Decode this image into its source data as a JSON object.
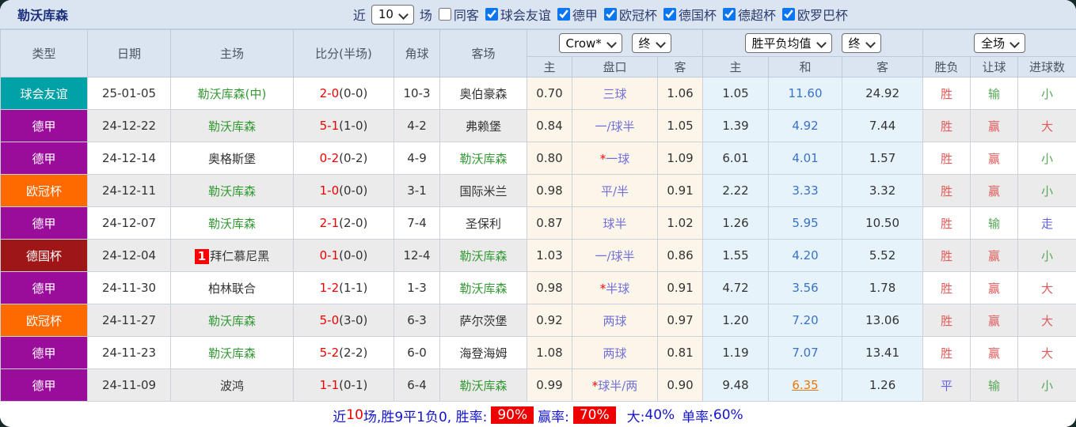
{
  "page": {
    "title": "勒沃库森"
  },
  "colors": {
    "accent_blue": "#0b76ef",
    "self_green": "#339933",
    "score_red": "#ee0000",
    "handicap_blue": "#7070d8",
    "draw_blue": "#3a72c8",
    "result_red": "#e05b5b",
    "result_green": "#57a657",
    "result_blue": "#6161e0",
    "highlight_orange": "#e8760d",
    "summary_blue": "#1414cc",
    "summary_red": "#ee0000"
  },
  "topbar": {
    "near_label": "近",
    "count_value": "10",
    "matches_label": "场",
    "same_venue_label": "同客",
    "same_venue_checked": false,
    "league_filters": [
      {
        "label": "球会友谊",
        "checked": true
      },
      {
        "label": "德甲",
        "checked": true
      },
      {
        "label": "欧冠杯",
        "checked": true
      },
      {
        "label": "德国杯",
        "checked": true
      },
      {
        "label": "德超杯",
        "checked": true
      },
      {
        "label": "欧罗巴杯",
        "checked": true
      }
    ]
  },
  "table": {
    "headers": {
      "type": "类型",
      "date": "日期",
      "home": "主场",
      "score": "比分(半场)",
      "corner": "角球",
      "away": "客场"
    },
    "selects": {
      "company": "Crow*",
      "company_time": "终",
      "avg_type": "胜平负均值",
      "avg_time": "终",
      "scope": "全场"
    },
    "sub_headers": [
      "主",
      "盘口",
      "客",
      "主",
      "和",
      "客",
      "胜负",
      "让球",
      "进球数"
    ],
    "league_colors": {
      "球会友谊": "#00a1a7",
      "德甲": "#9a0d9a",
      "欧冠杯": "#ff6a00",
      "德国杯": "#9e1616"
    },
    "rows": [
      {
        "league": "球会友谊",
        "date": "25-01-05",
        "home": "勒沃库森(中)",
        "home_self": true,
        "home_rank": "",
        "score": "2-0",
        "half": "(0-0)",
        "corner": "10-3",
        "away": "奥伯豪森",
        "away_self": false,
        "odds": [
          "0.70",
          "三球",
          "1.06"
        ],
        "star": false,
        "avg": [
          "1.05",
          "11.60",
          "24.92"
        ],
        "draw_highlight": false,
        "results": [
          [
            "胜",
            "red"
          ],
          [
            "输",
            "green"
          ],
          [
            "小",
            "green"
          ]
        ]
      },
      {
        "league": "德甲",
        "date": "24-12-22",
        "home": "勒沃库森",
        "home_self": true,
        "home_rank": "",
        "score": "5-1",
        "half": "(1-0)",
        "corner": "4-2",
        "away": "弗赖堡",
        "away_self": false,
        "odds": [
          "0.84",
          "一/球半",
          "1.05"
        ],
        "star": false,
        "avg": [
          "1.39",
          "4.92",
          "7.44"
        ],
        "draw_highlight": false,
        "results": [
          [
            "胜",
            "red"
          ],
          [
            "赢",
            "red"
          ],
          [
            "大",
            "red"
          ]
        ]
      },
      {
        "league": "德甲",
        "date": "24-12-14",
        "home": "奥格斯堡",
        "home_self": false,
        "home_rank": "",
        "score": "0-2",
        "half": "(0-2)",
        "corner": "4-9",
        "away": "勒沃库森",
        "away_self": true,
        "odds": [
          "0.80",
          "一球",
          "1.09"
        ],
        "star": true,
        "avg": [
          "6.01",
          "4.01",
          "1.57"
        ],
        "draw_highlight": false,
        "results": [
          [
            "胜",
            "red"
          ],
          [
            "赢",
            "red"
          ],
          [
            "小",
            "green"
          ]
        ]
      },
      {
        "league": "欧冠杯",
        "date": "24-12-11",
        "home": "勒沃库森",
        "home_self": true,
        "home_rank": "",
        "score": "1-0",
        "half": "(0-0)",
        "corner": "3-1",
        "away": "国际米兰",
        "away_self": false,
        "odds": [
          "0.98",
          "平/半",
          "0.91"
        ],
        "star": false,
        "avg": [
          "2.22",
          "3.33",
          "3.32"
        ],
        "draw_highlight": false,
        "results": [
          [
            "胜",
            "red"
          ],
          [
            "赢",
            "red"
          ],
          [
            "小",
            "green"
          ]
        ]
      },
      {
        "league": "德甲",
        "date": "24-12-07",
        "home": "勒沃库森",
        "home_self": true,
        "home_rank": "",
        "score": "2-1",
        "half": "(2-0)",
        "corner": "7-4",
        "away": "圣保利",
        "away_self": false,
        "odds": [
          "0.87",
          "球半",
          "1.02"
        ],
        "star": false,
        "avg": [
          "1.26",
          "5.95",
          "10.50"
        ],
        "draw_highlight": false,
        "results": [
          [
            "胜",
            "red"
          ],
          [
            "输",
            "green"
          ],
          [
            "走",
            "blue"
          ]
        ]
      },
      {
        "league": "德国杯",
        "date": "24-12-04",
        "home": "拜仁慕尼黑",
        "home_self": false,
        "home_rank": "1",
        "score": "0-1",
        "half": "(0-0)",
        "corner": "12-4",
        "away": "勒沃库森",
        "away_self": true,
        "odds": [
          "1.03",
          "一/球半",
          "0.86"
        ],
        "star": false,
        "avg": [
          "1.55",
          "4.20",
          "5.52"
        ],
        "draw_highlight": false,
        "results": [
          [
            "胜",
            "red"
          ],
          [
            "赢",
            "red"
          ],
          [
            "小",
            "green"
          ]
        ]
      },
      {
        "league": "德甲",
        "date": "24-11-30",
        "home": "柏林联合",
        "home_self": false,
        "home_rank": "",
        "score": "1-2",
        "half": "(1-1)",
        "corner": "1-3",
        "away": "勒沃库森",
        "away_self": true,
        "odds": [
          "0.98",
          "半球",
          "0.91"
        ],
        "star": true,
        "avg": [
          "4.72",
          "3.56",
          "1.78"
        ],
        "draw_highlight": false,
        "results": [
          [
            "胜",
            "red"
          ],
          [
            "赢",
            "red"
          ],
          [
            "大",
            "red"
          ]
        ]
      },
      {
        "league": "欧冠杯",
        "date": "24-11-27",
        "home": "勒沃库森",
        "home_self": true,
        "home_rank": "",
        "score": "5-0",
        "half": "(3-0)",
        "corner": "6-3",
        "away": "萨尔茨堡",
        "away_self": false,
        "odds": [
          "0.92",
          "两球",
          "0.97"
        ],
        "star": false,
        "avg": [
          "1.20",
          "7.20",
          "13.06"
        ],
        "draw_highlight": false,
        "results": [
          [
            "胜",
            "red"
          ],
          [
            "赢",
            "red"
          ],
          [
            "大",
            "red"
          ]
        ]
      },
      {
        "league": "德甲",
        "date": "24-11-23",
        "home": "勒沃库森",
        "home_self": true,
        "home_rank": "",
        "score": "5-2",
        "half": "(2-2)",
        "corner": "6-0",
        "away": "海登海姆",
        "away_self": false,
        "odds": [
          "1.08",
          "两球",
          "0.81"
        ],
        "star": false,
        "avg": [
          "1.19",
          "7.07",
          "13.41"
        ],
        "draw_highlight": false,
        "results": [
          [
            "胜",
            "red"
          ],
          [
            "赢",
            "red"
          ],
          [
            "大",
            "red"
          ]
        ]
      },
      {
        "league": "德甲",
        "date": "24-11-09",
        "home": "波鸿",
        "home_self": false,
        "home_rank": "",
        "score": "1-1",
        "half": "(0-1)",
        "corner": "6-4",
        "away": "勒沃库森",
        "away_self": true,
        "odds": [
          "0.99",
          "球半/两",
          "0.90"
        ],
        "star": true,
        "avg": [
          "9.48",
          "6.35",
          "1.26"
        ],
        "draw_highlight": true,
        "results": [
          [
            "平",
            "blue"
          ],
          [
            "输",
            "green"
          ],
          [
            "小",
            "green"
          ]
        ]
      }
    ]
  },
  "summary": {
    "near": "近",
    "count": "10",
    "middle": "场,胜9平1负0, 胜率:",
    "win_rate": "90%",
    "asia_label": "赢率:",
    "asia_rate": "70%",
    "big_label": "大:",
    "big_rate": "40%",
    "single_label": "单率:",
    "single_rate": "60%"
  }
}
